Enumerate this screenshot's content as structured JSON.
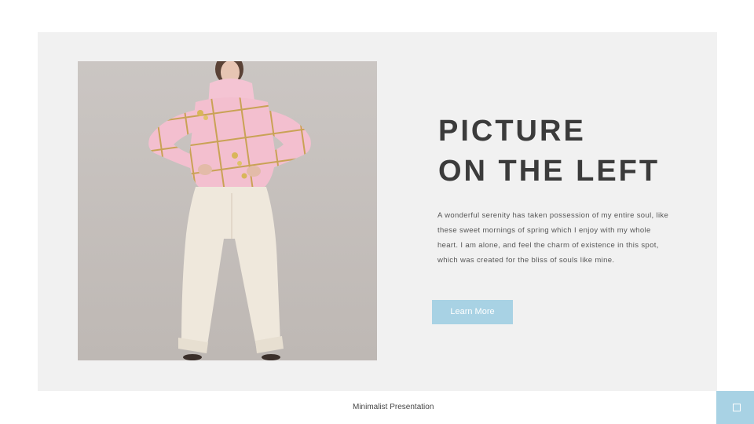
{
  "slide": {
    "title_line1": "PICTURE",
    "title_line2": "ON THE LEFT",
    "body": "A wonderful serenity has taken possession of my entire soul, like these sweet mornings of spring which I enjoy with my whole heart. I am alone, and feel the charm of existence in this spot, which was created for the bliss of souls like mine.",
    "button_label": "Learn More",
    "footer": "Minimalist Presentation"
  },
  "image": {
    "subject": "model in pink plaid turtleneck sweater and cream trousers"
  },
  "icons": {
    "corner": "square-icon"
  },
  "colors": {
    "panel_background": "#f1f1f1",
    "accent": "#a8d2e4",
    "title": "#3b3b3b",
    "body_text": "#555555",
    "sweater": "#f2bfcf",
    "trousers": "#efe8dc"
  }
}
